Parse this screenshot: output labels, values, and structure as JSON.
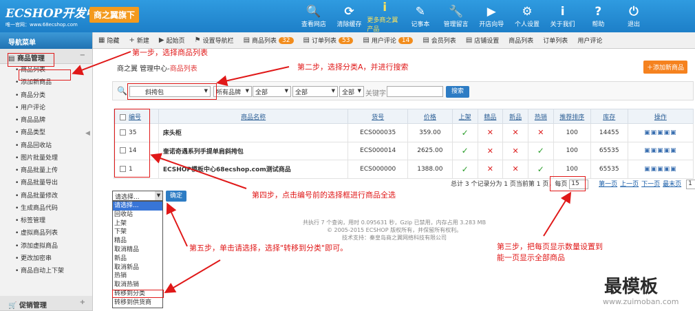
{
  "header": {
    "logo_text": "ECSHOP开发中心",
    "logo_sub": "唯一官网：www.68ecshop.com",
    "brand_tag": "商之翼旗下",
    "nav": [
      {
        "icon": "search-icon",
        "glyph": "🔍",
        "label": "查看网店"
      },
      {
        "icon": "refresh-icon",
        "glyph": "⟳",
        "label": "清除缓存"
      },
      {
        "icon": "info-icon",
        "glyph": "i",
        "label": "更多商之翼产品",
        "active": true
      },
      {
        "icon": "notebook-icon",
        "glyph": "✎",
        "label": "记事本"
      },
      {
        "icon": "wrench-icon",
        "glyph": "🔧",
        "label": "管理留言"
      },
      {
        "icon": "play-icon",
        "glyph": "▶",
        "label": "开店向导"
      },
      {
        "icon": "gear-icon",
        "glyph": "⚙",
        "label": "个人设置"
      },
      {
        "icon": "info-icon",
        "glyph": "i",
        "label": "关于我们"
      },
      {
        "icon": "help-icon",
        "glyph": "?",
        "label": "帮助"
      },
      {
        "icon": "power-icon",
        "glyph": "⏻",
        "label": "退出"
      }
    ]
  },
  "sidebar": {
    "title": "导航菜单",
    "group1": "商品管理",
    "group2": "促销管理",
    "items": [
      "商品列表",
      "添加新商品",
      "商品分类",
      "用户评论",
      "商品品牌",
      "商品类型",
      "商品回收站",
      "图片批量处理",
      "商品批量上传",
      "商品批量导出",
      "商品批量修改",
      "生成商品代码",
      "标签管理",
      "虚拟商品列表",
      "添加虚拟商品",
      "更改加密串",
      "商品自动上下架"
    ]
  },
  "toolbar": [
    {
      "icon": "ic",
      "label": "隐藏"
    },
    {
      "icon": "+",
      "label": "新建"
    },
    {
      "icon": "▶",
      "label": "起始页"
    },
    {
      "icon": "⚑",
      "label": "设置导航栏"
    },
    {
      "icon": "▤",
      "label": "商品列表",
      "badge": "32"
    },
    {
      "icon": "▤",
      "label": "订单列表",
      "badge": "53"
    },
    {
      "icon": "▤",
      "label": "用户评论",
      "badge": "14"
    },
    {
      "icon": "▤",
      "label": "会员列表"
    },
    {
      "icon": "▤",
      "label": "店铺设置"
    },
    {
      "icon": "",
      "label": "商品列表"
    },
    {
      "icon": "",
      "label": "订单列表"
    },
    {
      "icon": "",
      "label": "用户评论"
    }
  ],
  "breadcrumb": {
    "prefix": "商之翼 管理中心-",
    "current": "商品列表"
  },
  "add_button": "添加新商品",
  "filter": {
    "category": "斜挎包",
    "brand": "所有品牌",
    "opt1": "全部",
    "opt2": "全部",
    "opt3": "全部",
    "keyword_label": "关键字",
    "search": "搜索"
  },
  "table": {
    "headers": [
      "编号",
      "商品名称",
      "货号",
      "价格",
      "上架",
      "精品",
      "新品",
      "热销",
      "推荐排序",
      "库存",
      "操作"
    ],
    "rows": [
      {
        "id": "35",
        "name": "床头柜",
        "sn": "ECS000035",
        "price": "359.00",
        "onsale": true,
        "best": false,
        "new": false,
        "hot": false,
        "sort": "100",
        "stock": "14455"
      },
      {
        "id": "14",
        "name": "奎诺奇遇系列手提单肩斜挎包",
        "sn": "ECS000014",
        "price": "2625.00",
        "onsale": true,
        "best": false,
        "new": false,
        "hot": true,
        "sort": "100",
        "stock": "65535"
      },
      {
        "id": "1",
        "name": "ECSHOP模板中心68ecshop.com测试商品",
        "sn": "ECS000000",
        "price": "1388.00",
        "onsale": true,
        "best": false,
        "new": false,
        "hot": true,
        "sort": "100",
        "stock": "65535"
      }
    ]
  },
  "pager": {
    "summary": "总计 3 个记录分为 1 页当前第 1 页，",
    "per_page_label": "每页",
    "per_page": "15",
    "first": "第一页",
    "prev": "上一页",
    "next": "下一页",
    "last": "最末页",
    "page": "1"
  },
  "batch": {
    "placeholder": "请选择...",
    "confirm": "确定",
    "options": [
      "请选择...",
      "回收站",
      "上架",
      "下架",
      "精品",
      "取消精品",
      "新品",
      "取消新品",
      "热销",
      "取消热销",
      "转移到分类",
      "转移到供货商"
    ]
  },
  "footer": [
    "共执行 7 个查询，用时 0.095631 秒，Gzip 已禁用，内存占用 3.283 MB",
    "© 2005-2015 ECSHOP 版权所有，并保留所有权利。",
    "技术支持：秦皇岛商之翼网络科技有限公司"
  ],
  "annotations": {
    "step1": "第一步，选择商品列表",
    "step2": "第二步，选择分类A，并进行搜索",
    "step3_line1": "第三步，把每页显示数量设置到",
    "step3_line2": "能一页显示全部商品",
    "step4": "第四步，点击编号前的选择框进行商品全选",
    "step5": "第五步，单击请选择，选择\"转移到分类\"即可。"
  },
  "watermark": {
    "title": "最模板",
    "url": "www.zuimoban.com"
  }
}
